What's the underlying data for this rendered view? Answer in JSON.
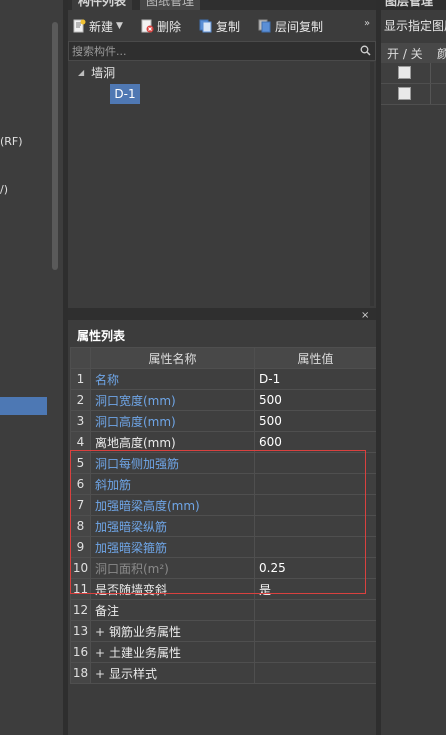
{
  "left_strip": {
    "fragments": [
      "(RF)",
      "/)"
    ]
  },
  "component_panel": {
    "tabs": [
      {
        "label": "构件列表"
      },
      {
        "label": "图纸管理"
      }
    ],
    "toolbar": {
      "new_label": "新建",
      "delete_label": "删除",
      "copy_label": "复制",
      "floor_copy_label": "层间复制",
      "more_label": "»"
    },
    "search": {
      "placeholder": "搜索构件..."
    },
    "tree": {
      "root_label": "墙洞",
      "child_label": "D-1"
    },
    "close_label": "×"
  },
  "property_panel": {
    "title": "属性列表",
    "columns": {
      "name": "属性名称",
      "value": "属性值"
    },
    "rows": [
      {
        "num": "1",
        "name": "名称",
        "value": "D-1",
        "style": "blue"
      },
      {
        "num": "2",
        "name": "洞口宽度(mm)",
        "value": "500",
        "style": "blue"
      },
      {
        "num": "3",
        "name": "洞口高度(mm)",
        "value": "500",
        "style": "blue"
      },
      {
        "num": "4",
        "name": "离地高度(mm)",
        "value": "600",
        "style": "white"
      },
      {
        "num": "5",
        "name": "洞口每侧加强筋",
        "value": "",
        "style": "blue"
      },
      {
        "num": "6",
        "name": "斜加筋",
        "value": "",
        "style": "blue"
      },
      {
        "num": "7",
        "name": "加强暗梁高度(mm)",
        "value": "",
        "style": "blue"
      },
      {
        "num": "8",
        "name": "加强暗梁纵筋",
        "value": "",
        "style": "blue"
      },
      {
        "num": "9",
        "name": "加强暗梁箍筋",
        "value": "",
        "style": "blue"
      },
      {
        "num": "10",
        "name": "洞口面积(m²)",
        "value": "0.25",
        "style": "gray"
      },
      {
        "num": "11",
        "name": "是否随墙变斜",
        "value": "是",
        "style": "white"
      },
      {
        "num": "12",
        "name": "备注",
        "value": "",
        "style": "white"
      },
      {
        "num": "13",
        "name": "钢筋业务属性",
        "value": "",
        "style": "white",
        "expandable": true
      },
      {
        "num": "16",
        "name": "土建业务属性",
        "value": "",
        "style": "white",
        "expandable": true
      },
      {
        "num": "18",
        "name": "显示样式",
        "value": "",
        "style": "white",
        "expandable": true
      }
    ],
    "expand_symbol": "+"
  },
  "layer_panel": {
    "tab_label": "图层管理",
    "show_label": "显示指定图层",
    "col_onoff": "开 / 关",
    "col_color": "颜色"
  },
  "colors": {
    "accent_blue": "#4f78b3",
    "property_blue_text": "#6fa6e8",
    "highlight_red": "#d9413f",
    "panel_bg": "#3c3c3c"
  }
}
